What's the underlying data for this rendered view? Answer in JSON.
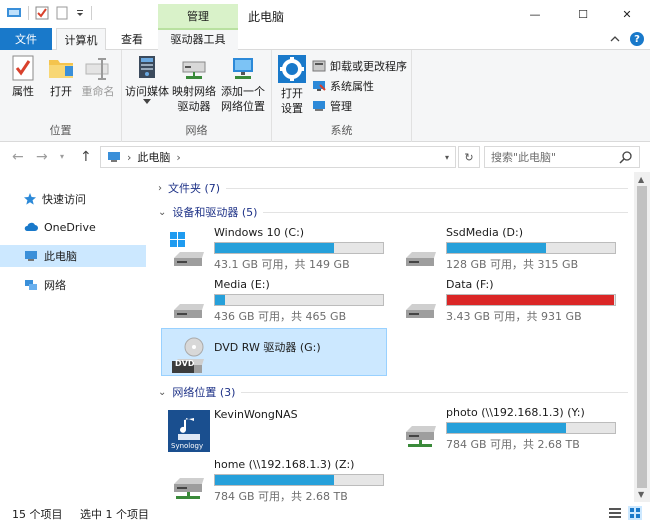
{
  "window": {
    "title": "此电脑",
    "context_tab": "管理",
    "minimize": "—",
    "maximize": "☐",
    "close": "✕"
  },
  "tabs": [
    {
      "label": "文件"
    },
    {
      "label": "计算机"
    },
    {
      "label": "查看"
    },
    {
      "label": "驱动器工具"
    }
  ],
  "ribbon": {
    "groups": [
      {
        "label": "位置",
        "buttons": [
          {
            "label": "属性"
          },
          {
            "label": "打开"
          },
          {
            "label": "重命名"
          }
        ]
      },
      {
        "label": "网络",
        "buttons": [
          {
            "label": "访问媒体"
          },
          {
            "label": "映射网络驱动器"
          },
          {
            "label": "添加一个网络位置"
          }
        ]
      },
      {
        "label": "系统",
        "buttons": [
          {
            "label": "打开设置"
          }
        ],
        "small": [
          {
            "label": "卸载或更改程序"
          },
          {
            "label": "系统属性"
          },
          {
            "label": "管理"
          }
        ]
      }
    ]
  },
  "address": {
    "path": "此电脑",
    "search_placeholder": "搜索\"此电脑\""
  },
  "nav": [
    {
      "label": "快速访问"
    },
    {
      "label": "OneDrive"
    },
    {
      "label": "此电脑"
    },
    {
      "label": "网络"
    }
  ],
  "sections": {
    "folders": "文件夹 (7)",
    "devices": "设备和驱动器 (5)",
    "network": "网络位置 (3)"
  },
  "drives": [
    {
      "name": "Windows 10 (C:)",
      "space": "43.1 GB 可用，共 149 GB",
      "used_fraction": 0.71
    },
    {
      "name": "SsdMedia (D:)",
      "space": "128 GB 可用，共 315 GB",
      "used_fraction": 0.59
    },
    {
      "name": "Media (E:)",
      "space": "436 GB 可用，共 465 GB",
      "used_fraction": 0.06
    },
    {
      "name": "Data (F:)",
      "space": "3.43 GB 可用，共 931 GB",
      "used_fraction": 0.996
    },
    {
      "name": "DVD RW 驱动器 (G:)",
      "icon_text": "DVD"
    }
  ],
  "network_locations": [
    {
      "name": "KevinWongNAS",
      "logo_text": "Synology"
    },
    {
      "name": "photo (\\\\192.168.1.3) (Y:)",
      "space": "784 GB 可用，共 2.68 TB",
      "used_fraction": 0.71
    },
    {
      "name": "home (\\\\192.168.1.3) (Z:)",
      "space": "784 GB 可用，共 2.68 TB",
      "used_fraction": 0.71
    }
  ],
  "status": {
    "count": "15 个项目",
    "selected": "选中 1 个项目"
  },
  "colors": {
    "accent": "#1979ca",
    "drive_bar": "#26a0da",
    "drive_bar_full": "#da2626",
    "selection": "#cce8ff",
    "context_tab": "#d9f2c9"
  }
}
